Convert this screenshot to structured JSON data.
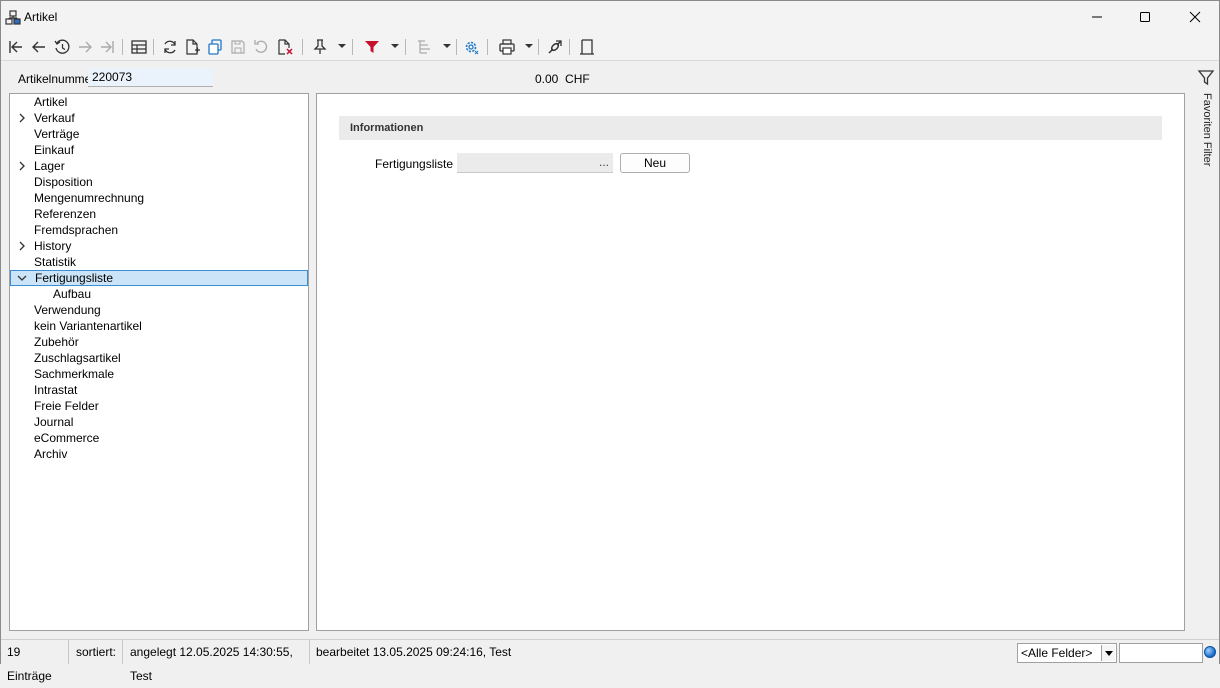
{
  "window": {
    "title": "Artikel",
    "icons": [
      "app-structure-icon",
      "minimize-icon",
      "maximize-icon",
      "close-icon"
    ]
  },
  "toolbar": {
    "icons": [
      "first-record-icon",
      "previous-record-icon",
      "history-icon",
      "next-record-icon",
      "last-record-icon",
      "table-view-icon",
      "refresh-icon",
      "new-document-icon",
      "copy-icon",
      "save-icon",
      "undo-icon",
      "delete-icon",
      "pin-icon",
      "filter-icon",
      "sort-icon",
      "settings-icon",
      "print-icon",
      "link-icon",
      "layout-icon"
    ]
  },
  "header": {
    "article_number_label": "Artikelnummer",
    "article_number_value": "220073",
    "amount": "0.00",
    "currency": "CHF"
  },
  "tree": {
    "items": [
      {
        "label": "Artikel",
        "expander": "none"
      },
      {
        "label": "Verkauf",
        "expander": "collapsed"
      },
      {
        "label": "Verträge",
        "expander": "none"
      },
      {
        "label": "Einkauf",
        "expander": "none"
      },
      {
        "label": "Lager",
        "expander": "collapsed"
      },
      {
        "label": "Disposition",
        "expander": "none"
      },
      {
        "label": "Mengenumrechnung",
        "expander": "none"
      },
      {
        "label": "Referenzen",
        "expander": "none"
      },
      {
        "label": "Fremdsprachen",
        "expander": "none"
      },
      {
        "label": "History",
        "expander": "collapsed"
      },
      {
        "label": "Statistik",
        "expander": "none"
      },
      {
        "label": "Fertigungsliste",
        "expander": "expanded",
        "selected": true
      },
      {
        "label": "Aufbau",
        "expander": "none",
        "child": true
      },
      {
        "label": "Verwendung",
        "expander": "none"
      },
      {
        "label": "kein Variantenartikel",
        "expander": "none"
      },
      {
        "label": "Zubehör",
        "expander": "none"
      },
      {
        "label": "Zuschlagsartikel",
        "expander": "none"
      },
      {
        "label": "Sachmerkmale",
        "expander": "none"
      },
      {
        "label": "Intrastat",
        "expander": "none"
      },
      {
        "label": "Freie Felder",
        "expander": "none"
      },
      {
        "label": "Journal",
        "expander": "none"
      },
      {
        "label": "eCommerce",
        "expander": "none"
      },
      {
        "label": "Archiv",
        "expander": "none"
      }
    ]
  },
  "main": {
    "group_title": "Informationen",
    "field_label": "Fertigungsliste",
    "field_value": "",
    "field_button": "...",
    "new_button": "Neu"
  },
  "sidebar_right": {
    "label": "Favoriten Filter"
  },
  "status": {
    "count": "19 Einträge",
    "sorted": "sortiert:",
    "created": "angelegt 12.05.2025 14:30:55, Test",
    "edited": "bearbeitet 13.05.2025 09:24:16, Test",
    "field_filter": "<Alle Felder>",
    "search_value": ""
  },
  "colors": {
    "selection_bg": "#cce4f7",
    "selection_border": "#3c8fd6",
    "filter_red": "#c8102e",
    "settings_blue": "#1f78c8"
  }
}
